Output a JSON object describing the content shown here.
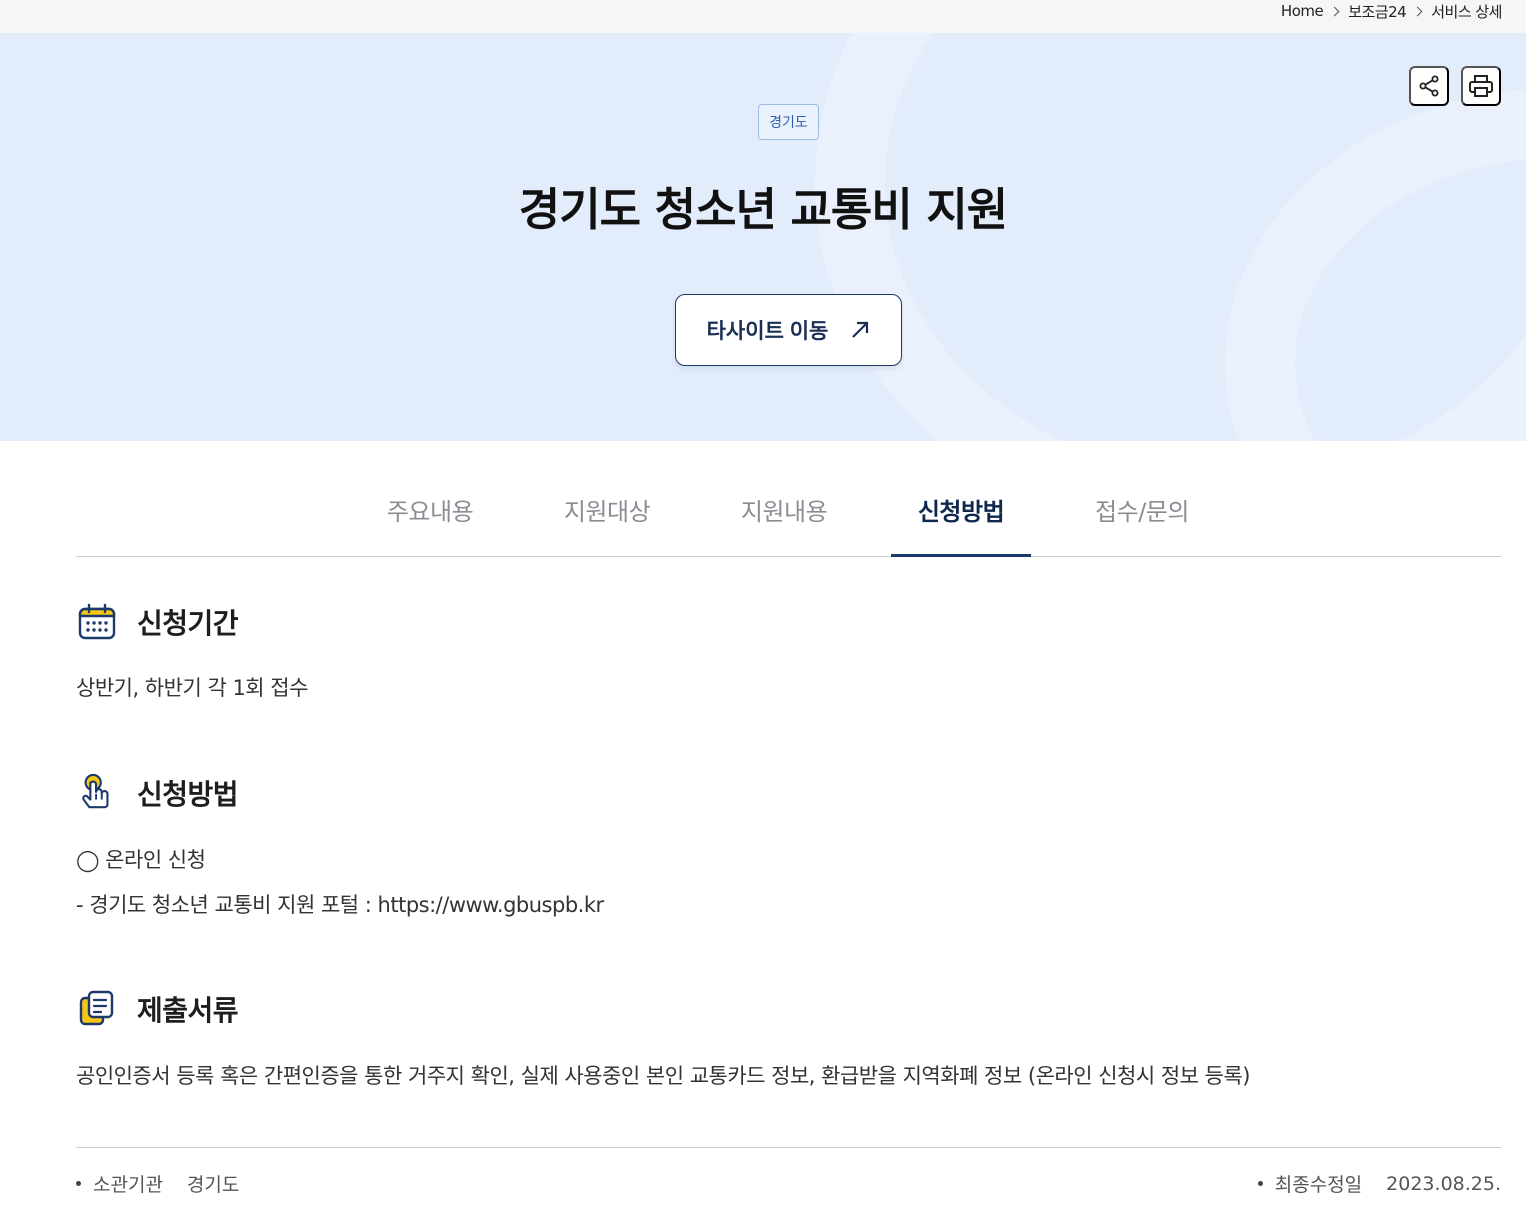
{
  "breadcrumb": {
    "home": "Home",
    "level1": "보조금24",
    "current": "서비스 상세"
  },
  "hero": {
    "region_badge": "경기도",
    "title": "경기도 청소년 교통비 지원",
    "external_button": "타사이트 이동",
    "share_icon": "share-icon",
    "print_icon": "print-icon"
  },
  "tabs": [
    {
      "label": "주요내용"
    },
    {
      "label": "지원대상"
    },
    {
      "label": "지원내용"
    },
    {
      "label": "신청방법",
      "active": true
    },
    {
      "label": "접수/문의"
    }
  ],
  "sections": {
    "period": {
      "icon": "calendar-icon",
      "title": "신청기간",
      "text": "상반기, 하반기 각 1회 접수"
    },
    "method": {
      "icon": "hand-pointer-icon",
      "title": "신청방법",
      "line1": "◯ 온라인 신청",
      "line2": "- 경기도 청소년 교통비 지원 포털 : https://www.gbuspb.kr"
    },
    "documents": {
      "icon": "document-icon",
      "title": "제출서류",
      "text": "공인인증서 등록 혹은 간편인증을 통한 거주지 확인, 실제 사용중인 본인 교통카드 정보, 환급받을 지역화폐 정보 (온라인 신청시 정보 등록)"
    }
  },
  "footer": {
    "agency_label": "소관기관",
    "agency_value": "경기도",
    "updated_label": "최종수정일",
    "updated_value": "2023.08.25."
  },
  "colors": {
    "hero_bg": "#e2ecfb",
    "accent": "#1b3a6b",
    "icon_yellow": "#f5c518"
  }
}
